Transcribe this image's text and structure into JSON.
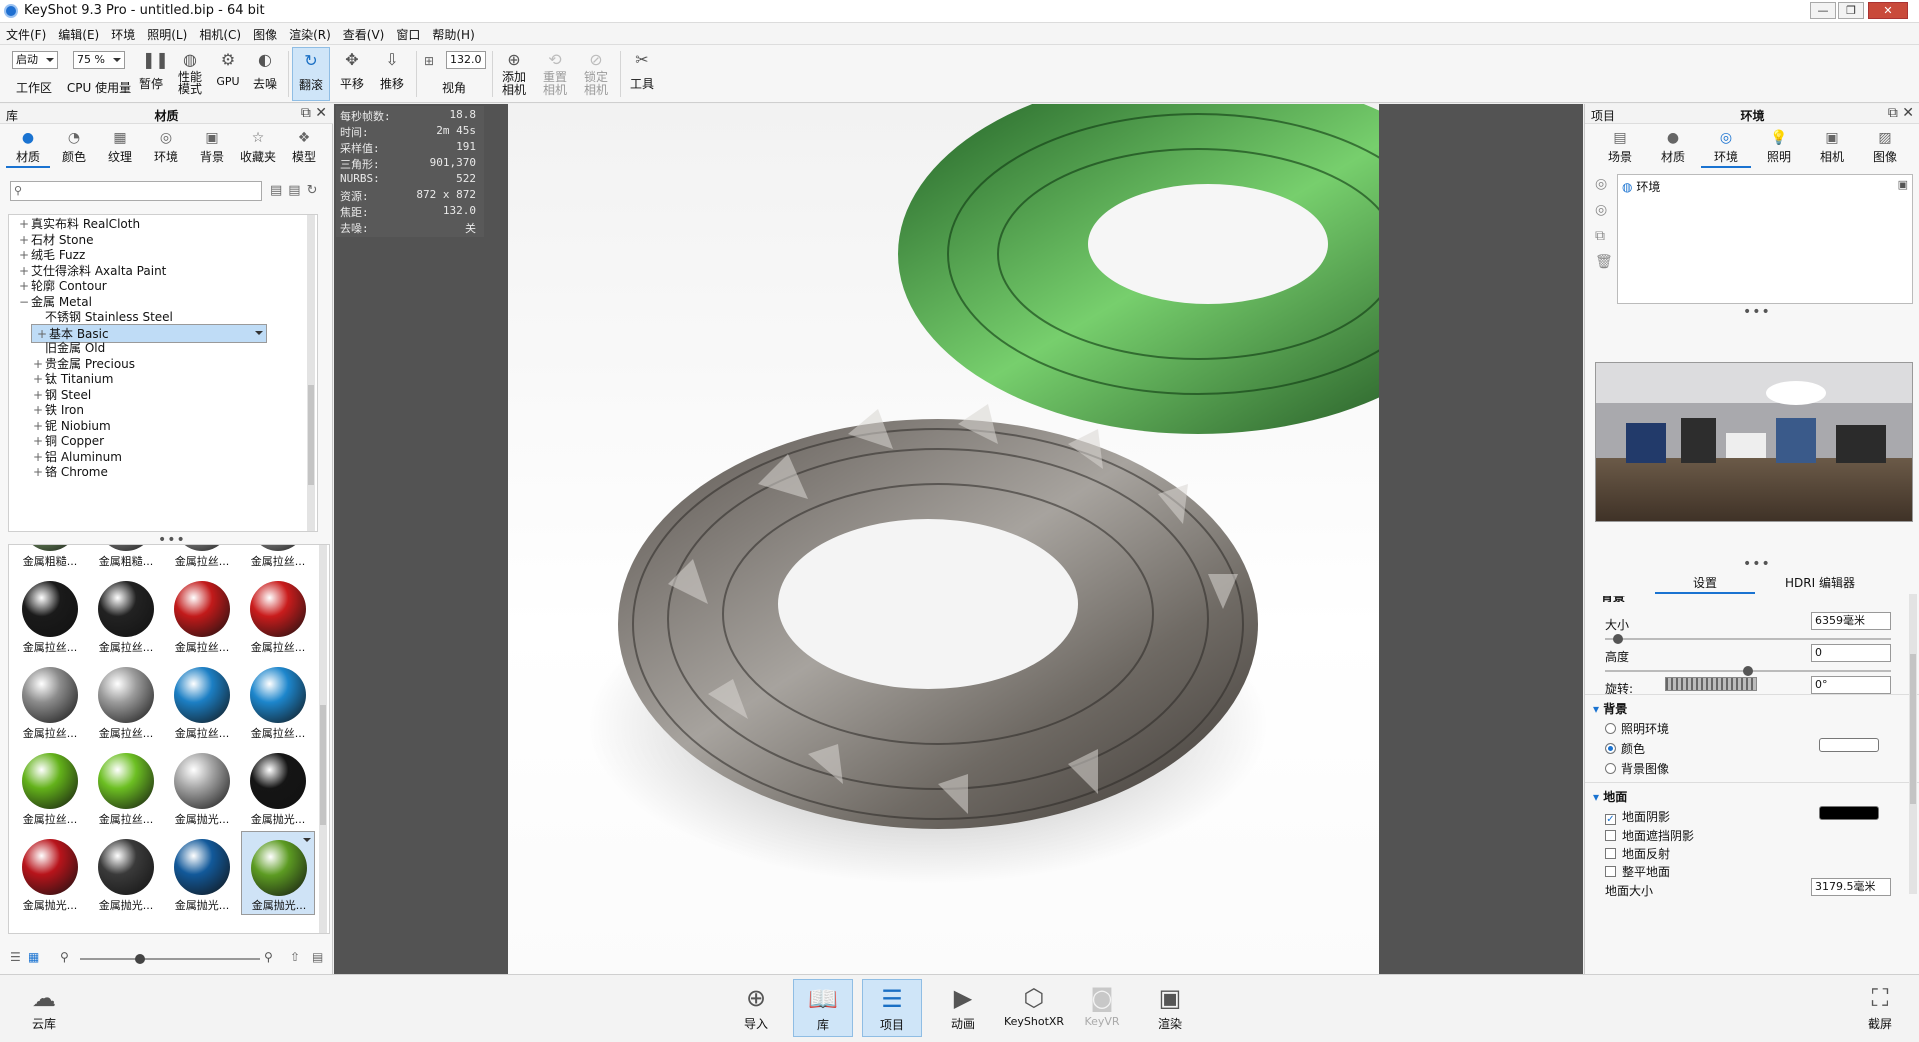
{
  "window": {
    "title": "KeyShot 9.3 Pro  - untitled.bip  - 64 bit",
    "controls": [
      "—",
      "❐",
      "✕"
    ]
  },
  "menu": [
    "文件(F)",
    "编辑(E)",
    "环境",
    "照明(L)",
    "相机(C)",
    "图像",
    "渲染(R)",
    "查看(V)",
    "窗口",
    "帮助(H)"
  ],
  "toolbar": {
    "workspace_select": "启动",
    "workspace_label": "工作区",
    "cpu_select": "75 %",
    "cpu_label": "CPU 使用量",
    "pause": "暂停",
    "perf_label1": "性能",
    "perf_label2": "模式",
    "gpu": "GPU",
    "denoise": "去噪",
    "tumble": "翻滚",
    "pan": "平移",
    "dolly": "推移",
    "fov_value": "132.0",
    "fov_label": "视角",
    "add_camera1": "添加",
    "add_camera2": "相机",
    "reset_camera1": "重置",
    "reset_camera2": "相机",
    "lock_camera1": "锁定",
    "lock_camera2": "相机",
    "tools": "工具"
  },
  "library": {
    "header_left": "库",
    "header_center": "材质",
    "tabs": [
      "材质",
      "颜色",
      "纹理",
      "环境",
      "背景",
      "收藏夹",
      "模型"
    ],
    "active_tab": 0,
    "search_placeholder": "",
    "tree": [
      {
        "pm": "+",
        "label": "真实布料 RealCloth",
        "indent": 0
      },
      {
        "pm": "+",
        "label": "石材 Stone",
        "indent": 0
      },
      {
        "pm": "+",
        "label": "绒毛 Fuzz",
        "indent": 0
      },
      {
        "pm": "+",
        "label": "艾仕得涂料 Axalta Paint",
        "indent": 0
      },
      {
        "pm": "+",
        "label": "轮廓 Contour",
        "indent": 0
      },
      {
        "pm": "−",
        "label": "金属 Metal",
        "indent": 0
      },
      {
        "pm": "",
        "label": "不锈钢 Stainless Steel",
        "indent": 1
      },
      {
        "pm": "+",
        "label": "基本 Basic",
        "indent": 1
      },
      {
        "pm": "",
        "label": "旧金属 Old",
        "indent": 1
      },
      {
        "pm": "+",
        "label": "贵金属 Precious",
        "indent": 1
      },
      {
        "pm": "+",
        "label": "钛 Titanium",
        "indent": 1
      },
      {
        "pm": "+",
        "label": "钢 Steel",
        "indent": 1
      },
      {
        "pm": "+",
        "label": "铁 Iron",
        "indent": 1
      },
      {
        "pm": "+",
        "label": "铌 Niobium",
        "indent": 1
      },
      {
        "pm": "+",
        "label": "铜 Copper",
        "indent": 1
      },
      {
        "pm": "+",
        "label": "铝 Aluminum",
        "indent": 1
      },
      {
        "pm": "+",
        "label": "铬 Chrome",
        "indent": 1
      }
    ],
    "selected_tree_index": 7,
    "thumbnails": [
      {
        "label": "金属粗糙...",
        "color": "#7a9f6a"
      },
      {
        "label": "金属粗糙...",
        "color": "#8a8a8a"
      },
      {
        "label": "金属拉丝...",
        "color": "#9a9a9a"
      },
      {
        "label": "金属拉丝...",
        "color": "#9a9a9a"
      },
      {
        "label": "金属拉丝...",
        "color": "#1a1a1a"
      },
      {
        "label": "金属拉丝...",
        "color": "#222222"
      },
      {
        "label": "金属拉丝...",
        "color": "#c21a1a"
      },
      {
        "label": "金属拉丝...",
        "color": "#c91c1c"
      },
      {
        "label": "金属拉丝...",
        "color": "#8c8c8c"
      },
      {
        "label": "金属拉丝...",
        "color": "#9b9b9b"
      },
      {
        "label": "金属拉丝...",
        "color": "#1c7fc4"
      },
      {
        "label": "金属拉丝...",
        "color": "#1d86cc"
      },
      {
        "label": "金属拉丝...",
        "color": "#63b21a"
      },
      {
        "label": "金属拉丝...",
        "color": "#6cbf22"
      },
      {
        "label": "金属抛光...",
        "color": "#a5a5a5"
      },
      {
        "label": "金属抛光...",
        "color": "#151515"
      },
      {
        "label": "金属抛光...",
        "color": "#b8141b"
      },
      {
        "label": "金属抛光...",
        "color": "#3a3a3a"
      },
      {
        "label": "金属抛光...",
        "color": "#12599a"
      },
      {
        "label": "金属抛光...",
        "color": "#5c9b22"
      }
    ],
    "selected_thumb_index": 19
  },
  "hud": [
    {
      "k": "每秒帧数:",
      "v": "18.8"
    },
    {
      "k": "时间:",
      "v": "2m 45s"
    },
    {
      "k": "采样值:",
      "v": "191"
    },
    {
      "k": "三角形:",
      "v": "901,370"
    },
    {
      "k": "NURBS:",
      "v": "522"
    },
    {
      "k": "资源:",
      "v": "872 x 872"
    },
    {
      "k": "焦距:",
      "v": "132.0"
    },
    {
      "k": "去噪:",
      "v": "关"
    }
  ],
  "project": {
    "header_left": "项目",
    "header_center": "环境",
    "tabs": [
      "场景",
      "材质",
      "环境",
      "照明",
      "相机",
      "图像"
    ],
    "active_tab": 2,
    "env_item": "环境",
    "subtabs": [
      "设置",
      "HDRI 编辑器"
    ],
    "active_subtab": 0,
    "partial_section": "背景",
    "size_label": "大小",
    "size_value": "6359毫米",
    "size_level": 0.03,
    "height_label": "高度",
    "height_value": "0",
    "height_level": 0.5,
    "rotation_label": "旋转:",
    "rotation_value": "0°",
    "background_section": "背景",
    "bg_options": [
      "照明环境",
      "颜色",
      "背景图像"
    ],
    "bg_selected": 1,
    "bg_color": "#ffffff",
    "ground_section": "地面",
    "ground_options": [
      {
        "label": "地面阴影",
        "checked": true
      },
      {
        "label": "地面遮挡阴影",
        "checked": false
      },
      {
        "label": "地面反射",
        "checked": false
      },
      {
        "label": "整平地面",
        "checked": false
      }
    ],
    "shadow_color": "#000000",
    "ground_size_label": "地面大小",
    "ground_size_value": "3179.5毫米"
  },
  "bottom": {
    "cloud": "云库",
    "import": "导入",
    "library": "库",
    "project": "项目",
    "animation": "动画",
    "keyshotxr": "KeyShotXR",
    "keyvr": "KeyVR",
    "render": "渲染",
    "screenshot": "截屏"
  },
  "colors": {
    "accent": "#1a73d1",
    "viewport_bg": "#535353",
    "selection": "#bfdcf6"
  }
}
